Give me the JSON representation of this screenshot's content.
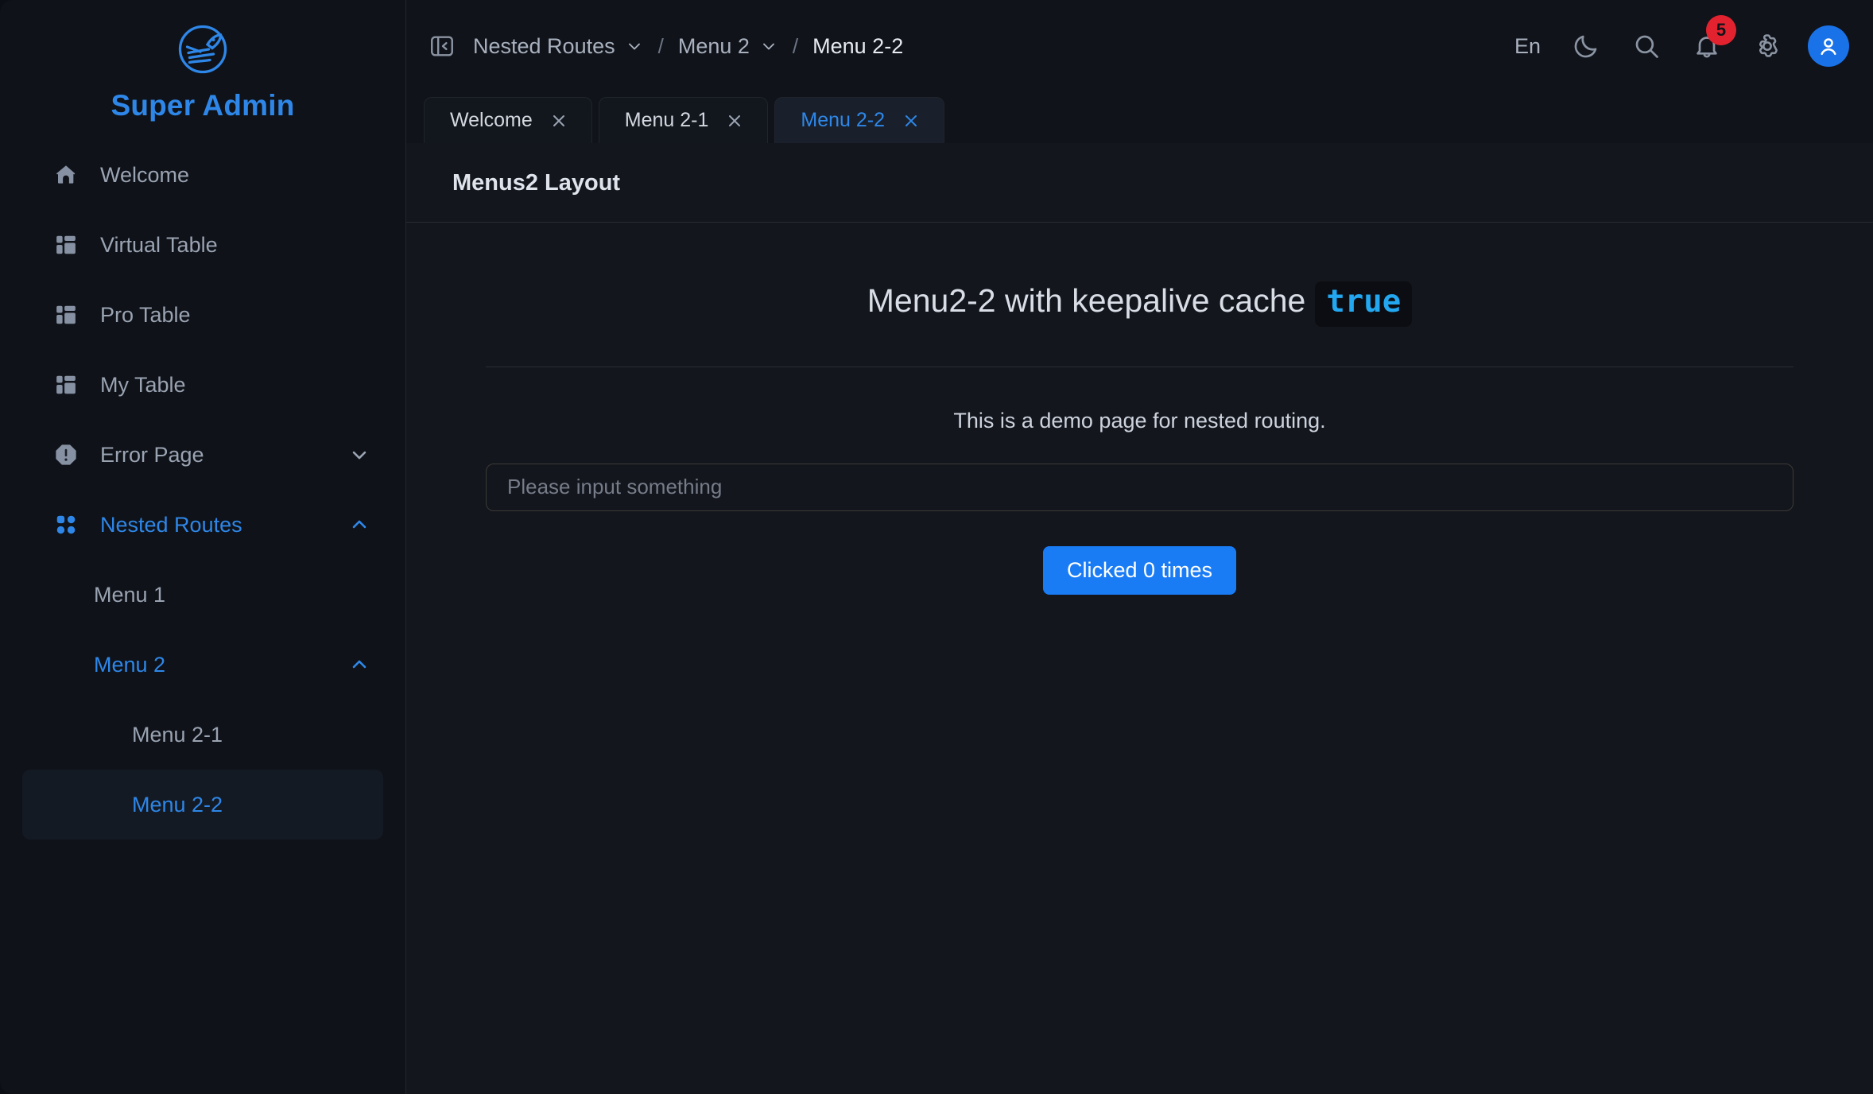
{
  "brand": {
    "title": "Super Admin",
    "logo_icon": "rocket-circle-logo",
    "accent_color": "#2e87e8"
  },
  "sidebar": {
    "items": [
      {
        "label": "Welcome",
        "icon": "home-icon",
        "active": false,
        "expandable": false
      },
      {
        "label": "Virtual Table",
        "icon": "table-layout-icon",
        "active": false,
        "expandable": false
      },
      {
        "label": "Pro Table",
        "icon": "table-layout-icon",
        "active": false,
        "expandable": false
      },
      {
        "label": "My Table",
        "icon": "table-layout-icon",
        "active": false,
        "expandable": false
      },
      {
        "label": "Error Page",
        "icon": "alert-octagon-icon",
        "active": false,
        "expandable": true,
        "chevron": "chevron-down-icon"
      },
      {
        "label": "Nested Routes",
        "icon": "grid-dots-icon",
        "active": true,
        "expandable": true,
        "chevron": "chevron-up-icon"
      }
    ],
    "submenu": [
      {
        "label": "Menu 1",
        "level": 2,
        "active": false,
        "selected": false,
        "chevron": ""
      },
      {
        "label": "Menu 2",
        "level": 2,
        "active": true,
        "selected": false,
        "chevron": "chevron-up-icon"
      },
      {
        "label": "Menu 2-1",
        "level": 3,
        "active": false,
        "selected": false,
        "chevron": ""
      },
      {
        "label": "Menu 2-2",
        "level": 3,
        "active": true,
        "selected": true,
        "chevron": ""
      }
    ]
  },
  "topbar": {
    "collapse_icon": "panel-collapse-left-icon",
    "breadcrumb": [
      {
        "label": "Nested Routes",
        "has_caret": true,
        "current": false
      },
      {
        "label": "Menu 2",
        "has_caret": true,
        "current": false
      },
      {
        "label": "Menu 2-2",
        "has_caret": false,
        "current": true
      }
    ],
    "separator": "/",
    "language_label": "En",
    "icons": [
      {
        "name": "moon-icon",
        "title": "dark-mode-toggle"
      },
      {
        "name": "search-icon",
        "title": "search"
      },
      {
        "name": "bell-icon",
        "title": "notifications"
      },
      {
        "name": "gear-icon",
        "title": "settings"
      }
    ],
    "notification_count": "5",
    "notification_badge_color": "#e2232f",
    "avatar_icon": "user-avatar-icon",
    "avatar_color": "#1a72e8"
  },
  "tabs": [
    {
      "label": "Welcome",
      "active": false,
      "close_icon": "close-icon"
    },
    {
      "label": "Menu 2-1",
      "active": false,
      "close_icon": "close-icon"
    },
    {
      "label": "Menu 2-2",
      "active": true,
      "close_icon": "close-icon"
    }
  ],
  "card": {
    "title": "Menus2 Layout"
  },
  "page": {
    "heading_text": "Menu2-2 with keepalive cache",
    "heading_code": "true",
    "code_color": "#22a7f0",
    "description": "This is a demo page for nested routing.",
    "input_value": "",
    "input_placeholder": "Please input something",
    "button_label": "Clicked 0 times",
    "button_color": "#1a7cf5"
  }
}
